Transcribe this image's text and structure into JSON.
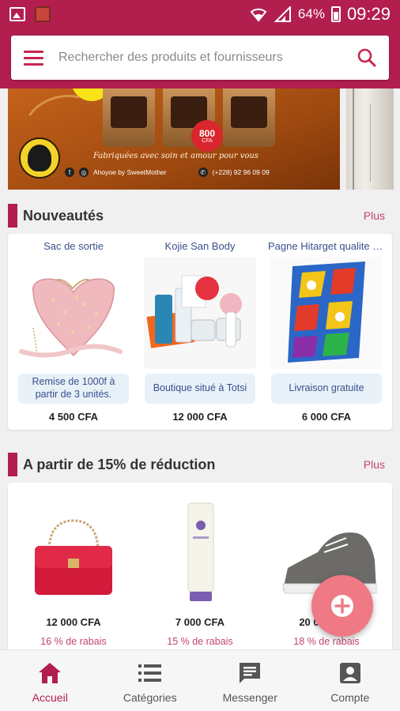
{
  "status_bar": {
    "battery": "64%",
    "time": "09:29"
  },
  "search": {
    "placeholder": "Rechercher des produits et fournisseurs"
  },
  "banner": {
    "tagline": "Fabriquées avec soin et amour pour vous",
    "price_badge": "800",
    "price_badge_unit": "CFA",
    "footer_name": "Ahoyoe by SweetMother",
    "footer_phone": "(+228) 92 96 09 09"
  },
  "sections": {
    "new": {
      "title": "Nouveautés",
      "more": "Plus",
      "products": [
        {
          "name": "Sac de sortie",
          "tag": "Remise de 1000f à partir de 3 unités.",
          "price": "4 500 CFA"
        },
        {
          "name": "Kojie San Body",
          "tag": "Boutique situé à Totsi",
          "price": "12 000 CFA"
        },
        {
          "name": "Pagne Hitarget qualite s...",
          "tag": "Livraison gratuite",
          "price": "6 000 CFA"
        }
      ]
    },
    "discount": {
      "title": "A partir de 15% de réduction",
      "more": "Plus",
      "products": [
        {
          "price": "12 000 CFA",
          "discount": "16 % de rabais"
        },
        {
          "price": "7 000 CFA",
          "discount": "15 % de rabais"
        },
        {
          "price": "20 000 CFA",
          "discount": "18 % de rabais"
        }
      ]
    }
  },
  "bottom_nav": [
    {
      "label": "Accueil",
      "icon": "home-icon",
      "active": true
    },
    {
      "label": "Catégories",
      "icon": "list-icon",
      "active": false
    },
    {
      "label": "Messenger",
      "icon": "message-icon",
      "active": false
    },
    {
      "label": "Compte",
      "icon": "account-icon",
      "active": false
    }
  ],
  "colors": {
    "brand": "#b21f4f",
    "fab": "#ef7a85",
    "link": "#3b4f8c",
    "discount": "#c2456d"
  }
}
